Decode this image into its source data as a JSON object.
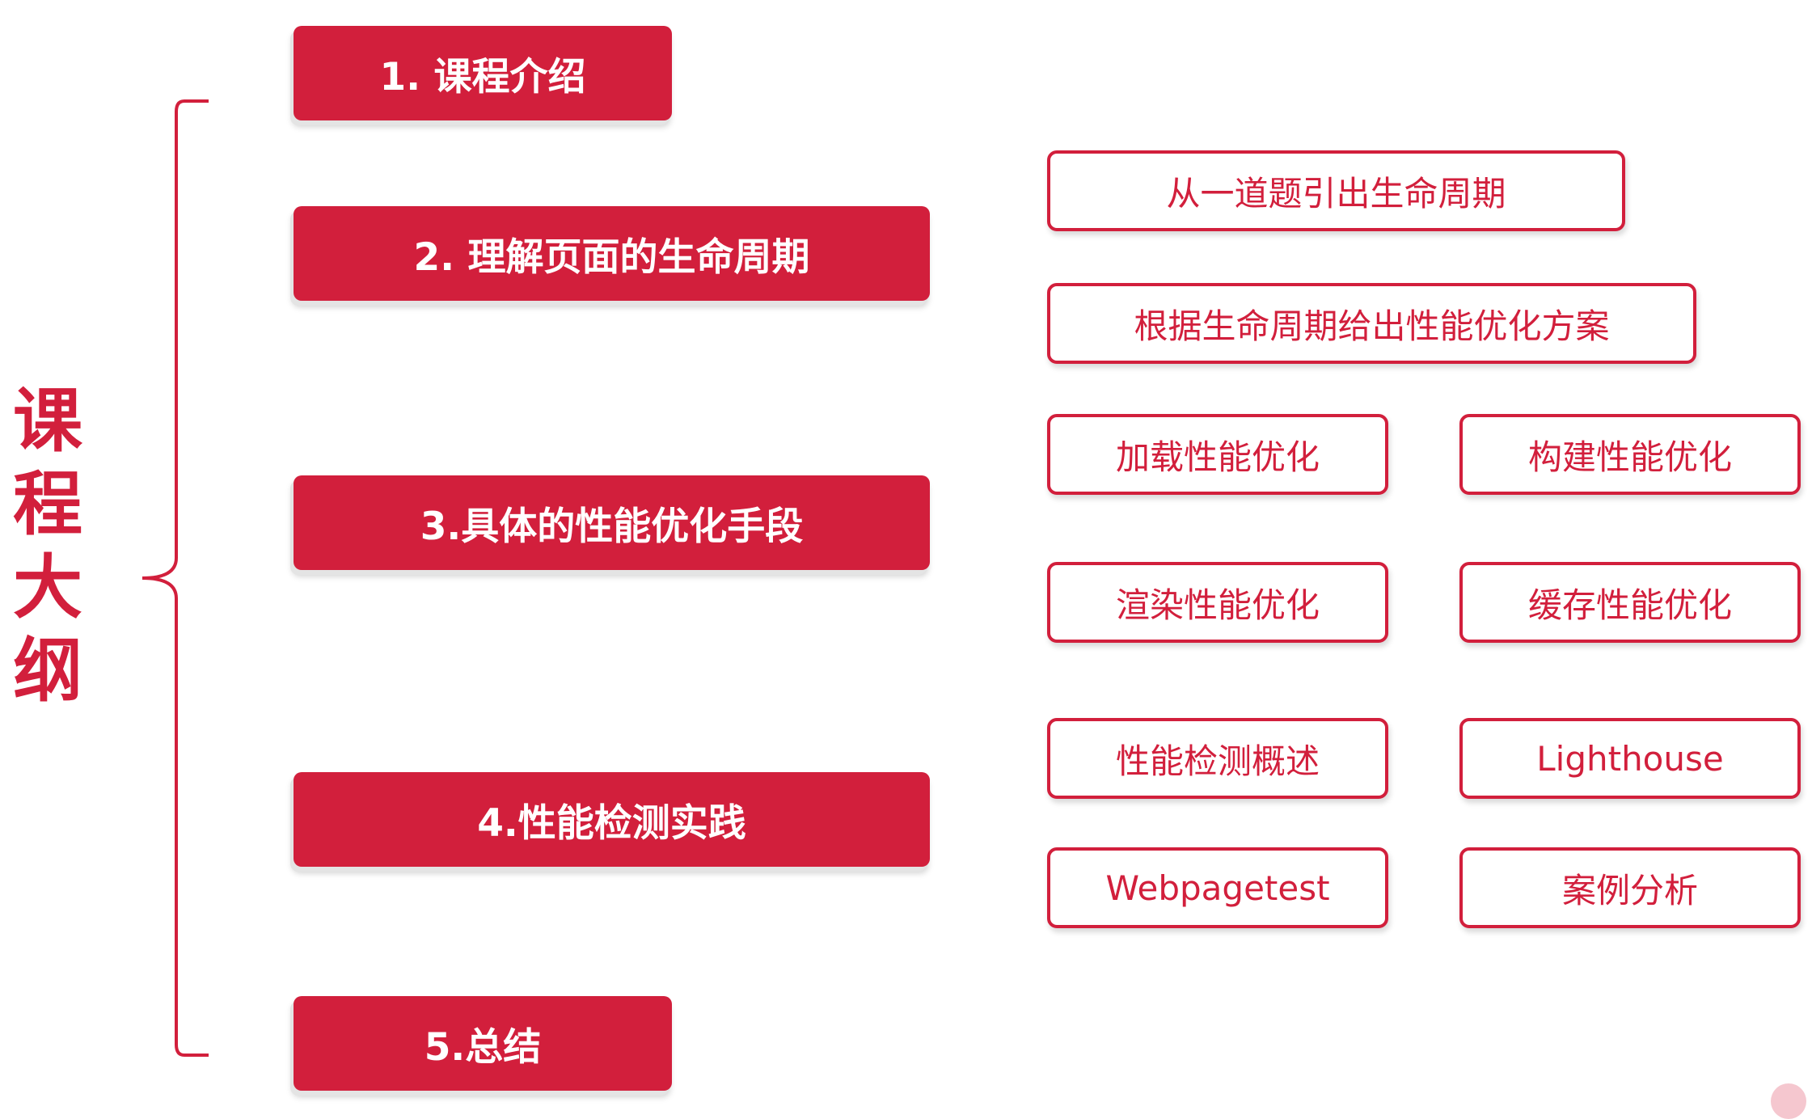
{
  "title": [
    "课",
    "程",
    "大",
    "纲"
  ],
  "colors": {
    "accent": "#d21f3c",
    "text_on_accent": "#ffffff",
    "background": "#ffffff"
  },
  "sections": [
    {
      "label": "1. 课程介绍"
    },
    {
      "label": "2. 理解页面的生命周期"
    },
    {
      "label": "3.具体的性能优化手段"
    },
    {
      "label": "4.性能检测实践"
    },
    {
      "label": "5.总结"
    }
  ],
  "subtopics": {
    "lifecycle": [
      "从一道题引出生命周期",
      "根据生命周期给出性能优化方案"
    ],
    "optimization": [
      "加载性能优化",
      "构建性能优化",
      "渲染性能优化",
      "缓存性能优化"
    ],
    "testing": [
      "性能检测概述",
      "Lighthouse",
      "Webpagetest",
      "案例分析"
    ]
  }
}
